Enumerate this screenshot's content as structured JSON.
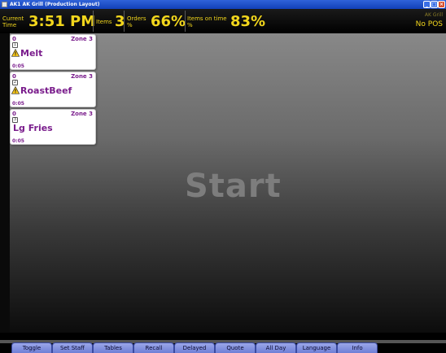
{
  "window": {
    "title": "AK1 AK Grill (Production Layout)"
  },
  "stats": {
    "current_time_label_1": "Current",
    "current_time_label_2": "Time",
    "current_time_value": "3:51 PM",
    "items_label": "Items",
    "items_value": "3",
    "orders_label_1": "Orders",
    "orders_label_2": "%",
    "orders_value": "66%",
    "ontime_label_1": "Items on time",
    "ontime_label_2": "%",
    "ontime_value": "83%",
    "store_name": "AK Grill",
    "pos_status": "No POS"
  },
  "main": {
    "watermark": "Start"
  },
  "tickets": [
    {
      "number": "0",
      "zone": "Zone 3",
      "seat": "1",
      "warning": true,
      "item": "Melt",
      "elapsed": "0:05"
    },
    {
      "number": "0",
      "zone": "Zone 3",
      "seat": "2",
      "warning": true,
      "item": "RoastBeef",
      "elapsed": "0:05"
    },
    {
      "number": "0",
      "zone": "Zone 3",
      "seat": "3",
      "warning": false,
      "item": "Lg Fries",
      "elapsed": "0:05"
    }
  ],
  "tabs": [
    "Toggle",
    "Set Staff",
    "Tables",
    "Recall",
    "Delayed",
    "Quote",
    "All Day",
    "Language",
    "Info"
  ],
  "colors": {
    "accent_yellow": "#f2d61c",
    "ticket_text": "#7a1d8c",
    "tab_blue": "#8090e0"
  },
  "icons": {
    "warning": "warning-icon"
  }
}
